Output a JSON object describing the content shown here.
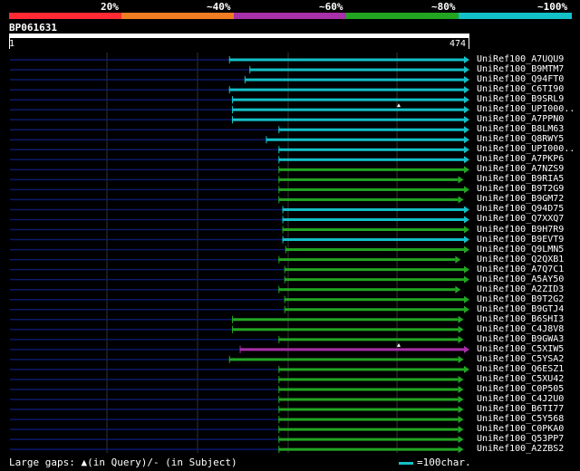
{
  "legend": {
    "segments": [
      {
        "label": "20%",
        "color": "#ff2a33"
      },
      {
        "label": "~40%",
        "color": "#f07d22"
      },
      {
        "label": "~60%",
        "color": "#a830a8"
      },
      {
        "label": "~80%",
        "color": "#22a622"
      },
      {
        "label": "~100%",
        "color": "#13c0c8"
      }
    ]
  },
  "query": {
    "name": "BP061631",
    "start": "1",
    "end": "474",
    "length": 474
  },
  "colors": {
    "cyan": "#13c0c8",
    "green": "#22a622",
    "purple": "#a830a8",
    "navy": "#0a1a6a",
    "grid": "#333333"
  },
  "hits": [
    {
      "label": "UniRef100_A7UQU9",
      "start": 227,
      "end": 474,
      "color": "cyan"
    },
    {
      "label": "UniRef100_B9MTM7",
      "start": 248,
      "end": 474,
      "color": "cyan"
    },
    {
      "label": "UniRef100_Q94FT0",
      "start": 243,
      "end": 474,
      "color": "cyan"
    },
    {
      "label": "UniRef100_C6TI90",
      "start": 227,
      "end": 474,
      "color": "cyan"
    },
    {
      "label": "UniRef100_B9SRL9",
      "start": 230,
      "end": 474,
      "color": "cyan"
    },
    {
      "label": "UniRef100_UPI000..",
      "start": 230,
      "end": 474,
      "color": "cyan",
      "gap": true
    },
    {
      "label": "UniRef100_A7PPN0",
      "start": 230,
      "end": 474,
      "color": "cyan"
    },
    {
      "label": "UniRef100_B8LM63",
      "start": 278,
      "end": 474,
      "color": "cyan"
    },
    {
      "label": "UniRef100_Q8RWY5",
      "start": 265,
      "end": 474,
      "color": "cyan"
    },
    {
      "label": "UniRef100_UPI000..",
      "start": 278,
      "end": 474,
      "color": "cyan"
    },
    {
      "label": "UniRef100_A7PKP6",
      "start": 278,
      "end": 474,
      "color": "cyan"
    },
    {
      "label": "UniRef100_A7NZS9",
      "start": 278,
      "end": 474,
      "color": "green"
    },
    {
      "label": "UniRef100_B9RIA5",
      "start": 278,
      "end": 468,
      "color": "green"
    },
    {
      "label": "UniRef100_B9T2G9",
      "start": 278,
      "end": 474,
      "color": "green"
    },
    {
      "label": "UniRef100_B9GM72",
      "start": 278,
      "end": 468,
      "color": "green"
    },
    {
      "label": "UniRef100_Q94D75",
      "start": 282,
      "end": 474,
      "color": "cyan"
    },
    {
      "label": "UniRef100_Q7XXQ7",
      "start": 282,
      "end": 474,
      "color": "cyan"
    },
    {
      "label": "UniRef100_B9H7R9",
      "start": 282,
      "end": 474,
      "color": "green"
    },
    {
      "label": "UniRef100_B9EVT9",
      "start": 282,
      "end": 474,
      "color": "cyan"
    },
    {
      "label": "UniRef100_Q9LMN5",
      "start": 285,
      "end": 474,
      "color": "green"
    },
    {
      "label": "UniRef100_Q2QXB1",
      "start": 278,
      "end": 465,
      "color": "green"
    },
    {
      "label": "UniRef100_A7Q7C1",
      "start": 284,
      "end": 474,
      "color": "green"
    },
    {
      "label": "UniRef100_A5AY50",
      "start": 284,
      "end": 474,
      "color": "green"
    },
    {
      "label": "UniRef100_A2ZID3",
      "start": 278,
      "end": 465,
      "color": "green"
    },
    {
      "label": "UniRef100_B9T2G2",
      "start": 284,
      "end": 474,
      "color": "green"
    },
    {
      "label": "UniRef100_B9GTJ4",
      "start": 284,
      "end": 474,
      "color": "green"
    },
    {
      "label": "UniRef100_B6SHI3",
      "start": 230,
      "end": 468,
      "color": "green"
    },
    {
      "label": "UniRef100_C4J8V8",
      "start": 230,
      "end": 468,
      "color": "green"
    },
    {
      "label": "UniRef100_B9GWA3",
      "start": 278,
      "end": 468,
      "color": "green"
    },
    {
      "label": "UniRef100_C5XIW5",
      "start": 238,
      "end": 474,
      "color": "purple",
      "gap": true
    },
    {
      "label": "UniRef100_C5YSA2",
      "start": 227,
      "end": 468,
      "color": "green"
    },
    {
      "label": "UniRef100_Q6ESZ1",
      "start": 278,
      "end": 474,
      "color": "green"
    },
    {
      "label": "UniRef100_C5XU42",
      "start": 278,
      "end": 468,
      "color": "green"
    },
    {
      "label": "UniRef100_C0P505",
      "start": 278,
      "end": 468,
      "color": "green"
    },
    {
      "label": "UniRef100_C4J2U0",
      "start": 278,
      "end": 468,
      "color": "green"
    },
    {
      "label": "UniRef100_B6TI77",
      "start": 278,
      "end": 468,
      "color": "green"
    },
    {
      "label": "UniRef100_C5Y568",
      "start": 278,
      "end": 468,
      "color": "green"
    },
    {
      "label": "UniRef100_C0PKA0",
      "start": 278,
      "end": 468,
      "color": "green"
    },
    {
      "label": "UniRef100_Q53PP7",
      "start": 278,
      "end": 468,
      "color": "green"
    },
    {
      "label": "UniRef100_A2ZBS2",
      "start": 278,
      "end": 468,
      "color": "green"
    }
  ],
  "footer": {
    "gaps_text": "Large gaps: ▲(in Query)/- (in Subject)",
    "scale_text": "=100char."
  }
}
